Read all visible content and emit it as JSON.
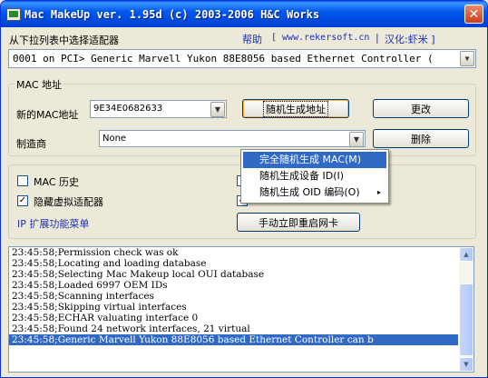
{
  "window": {
    "title": "Mac MakeUp ver. 1.95d (c) 2003-2006 H&C Works",
    "close_glyph": "✕"
  },
  "header": {
    "instruction": "从下拉列表中选择适配器",
    "help_link": "帮助",
    "site_link": "[ www.rekersoft.cn",
    "separator": "|",
    "translation": "汉化:虾米 ]"
  },
  "adapter": {
    "selected": "0001 on PCI> Generic Marvell Yukon 88E8056 based Ethernet Controller (",
    "arrow_icon": "chevron-down-icon"
  },
  "mac_group": {
    "title": "MAC 地址",
    "new_mac_label": "新的MAC地址",
    "new_mac_value": "9E34E0682633",
    "manufacturer_label": "制造商",
    "manufacturer_value": "None",
    "random_button": "随机生成地址",
    "change_button": "更改",
    "remove_button": "删除"
  },
  "options": {
    "mac_history_label": "MAC 历史",
    "mac_history_checked": false,
    "hide_virtual_label": "隐藏虚拟适配器",
    "hide_virtual_checked": true,
    "check_mark": "✓",
    "ip_menu_label": "IP 扩展功能菜单",
    "restart_nic_button": "手动立即重启网卡"
  },
  "context_menu": {
    "items": [
      {
        "label": "完全随机生成 MAC(M)",
        "highlighted": true
      },
      {
        "label": "随机生成设备 ID(I)",
        "highlighted": false
      },
      {
        "label": "随机生成 OID 编码(O)",
        "highlighted": false,
        "submenu": "▸"
      }
    ]
  },
  "log": {
    "lines": [
      "23:45:58;Permission check was ok",
      "23:45:58;Locating and loading database",
      "23:45:58;Selecting Mac Makeup local OUI database",
      "23:45:58;Loaded 6997 OEM IDs",
      "23:45:58;Scanning interfaces",
      "23:45:58;Skipping virtual interfaces",
      "23:45:58;ECHAR valuating interface 0",
      "23:45:58;Found 24 network interfaces, 21 virtual",
      "23:45:58;Generic Marvell Yukon 88E8056 based Ethernet Controller can b"
    ],
    "selected_index": 8,
    "scroll_up": "▲",
    "scroll_down": "▼"
  },
  "colors": {
    "title_bar": "#0058ee",
    "link_blue": "#1c2fb6",
    "selection": "#316ac5"
  }
}
